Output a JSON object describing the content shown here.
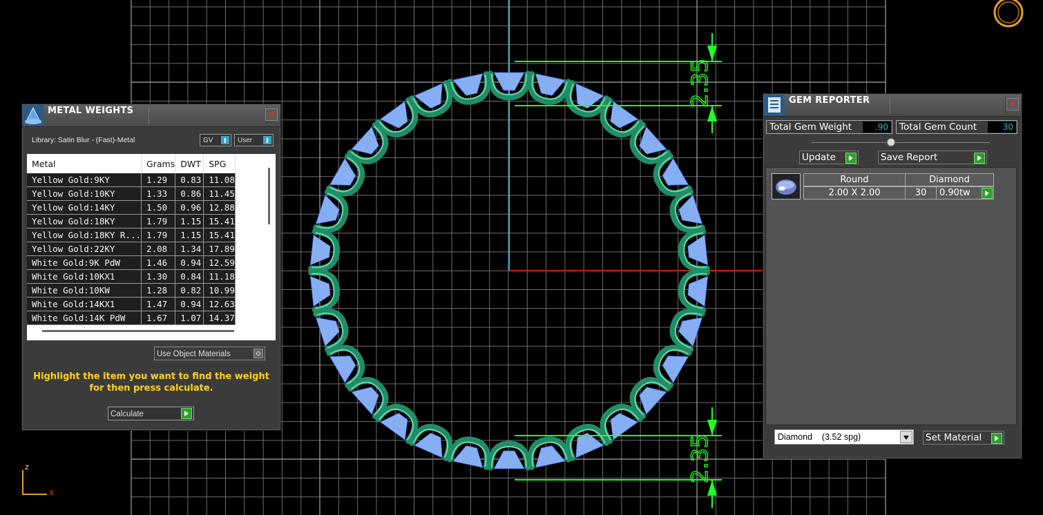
{
  "viewport": {
    "dimension_top": "2.35",
    "dimension_bottom": "2.35",
    "axis_z": "z",
    "axis_x": "x",
    "ring_icon": "ring-icon",
    "colors": {
      "grid": "#777777",
      "metal": "#1f8e66",
      "gem": "#86aef2",
      "dimension": "#22ff22"
    }
  },
  "metal_weights": {
    "title": "METAL WEIGHTS",
    "close": "×",
    "library": "Library: Satin Blur - (Fast)-Metal",
    "toggle_gv": "GV",
    "toggle_user": "User",
    "columns": [
      "Metal",
      "Grams",
      "DWT",
      "SPG"
    ],
    "rows": [
      [
        "Yellow Gold:9KY",
        "1.29",
        "0.83",
        "11.08"
      ],
      [
        "Yellow Gold:10KY",
        "1.33",
        "0.86",
        "11.45"
      ],
      [
        "Yellow Gold:14KY",
        "1.50",
        "0.96",
        "12.88"
      ],
      [
        "Yellow Gold:18KY",
        "1.79",
        "1.15",
        "15.41"
      ],
      [
        "Yellow Gold:18KY R...",
        "1.79",
        "1.15",
        "15.41"
      ],
      [
        "Yellow Gold:22KY",
        "2.08",
        "1.34",
        "17.89"
      ],
      [
        "White Gold:9K PdW",
        "1.46",
        "0.94",
        "12.59"
      ],
      [
        "White Gold:10KX1",
        "1.30",
        "0.84",
        "11.18"
      ],
      [
        "White Gold:10KW",
        "1.28",
        "0.82",
        "10.99"
      ],
      [
        "White Gold:14KX1",
        "1.47",
        "0.94",
        "12.63"
      ],
      [
        "White Gold:14K PdW",
        "1.67",
        "1.07",
        "14.37"
      ]
    ],
    "use_object_materials": "Use Object Materials",
    "hint": "Highlight the item you want to find the weight for then press calculate.",
    "calculate": "Calculate"
  },
  "gem_reporter": {
    "title": "GEM REPORTER",
    "close": "×",
    "total_weight_label": "Total Gem Weight",
    "total_weight_value": ".90",
    "total_count_label": "Total Gem Count",
    "total_count_value": "30",
    "update": "Update",
    "save_report": "Save Report",
    "gem": {
      "shape": "Round",
      "type": "Diamond",
      "size": "2.00 X 2.00",
      "count": "30",
      "weight": "0.90tw"
    },
    "material": "Diamond    (3.52 spg)",
    "set_material": "Set Material"
  }
}
